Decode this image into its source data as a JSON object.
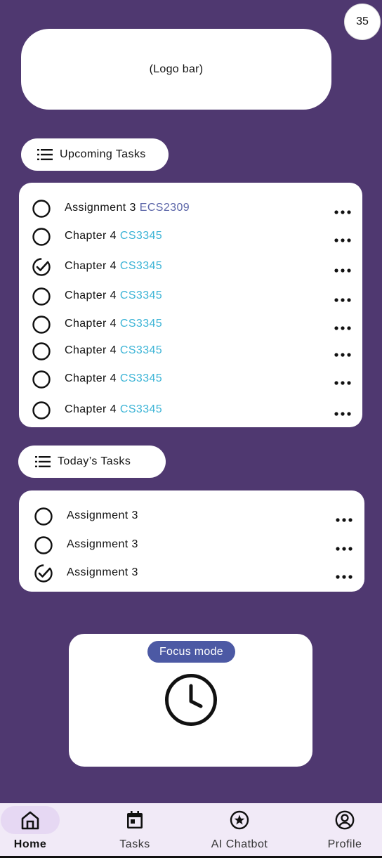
{
  "header": {
    "badge_count": "35",
    "logo_bar_text": "(Logo bar)"
  },
  "upcoming": {
    "title": "Upcoming Tasks",
    "tasks": [
      {
        "name": "Assignment 3",
        "course": "ECS2309",
        "done": false
      },
      {
        "name": "Chapter 4",
        "course": "CS3345",
        "done": false
      },
      {
        "name": "Chapter 4",
        "course": "CS3345",
        "done": true
      },
      {
        "name": "Chapter 4",
        "course": "CS3345",
        "done": false
      },
      {
        "name": "Chapter 4",
        "course": "CS3345",
        "done": false
      },
      {
        "name": "Chapter 4",
        "course": "CS3345",
        "done": false
      },
      {
        "name": "Chapter 4",
        "course": "CS3345",
        "done": false
      },
      {
        "name": "Chapter 4",
        "course": "CS3345",
        "done": false
      }
    ]
  },
  "today": {
    "title": "Today’s Tasks",
    "tasks": [
      {
        "name": "Assignment 3",
        "done": false
      },
      {
        "name": "Assignment 3",
        "done": false
      },
      {
        "name": "Assignment 3",
        "done": true
      }
    ]
  },
  "focus": {
    "button_label": "Focus mode",
    "icon": "clock-icon"
  },
  "nav": {
    "items": [
      {
        "label": "Home",
        "icon": "home-icon",
        "active": true
      },
      {
        "label": "Tasks",
        "icon": "calendar-icon",
        "active": false
      },
      {
        "label": "AI Chatbot",
        "icon": "star-icon",
        "active": false
      },
      {
        "label": "Profile",
        "icon": "account-icon",
        "active": false
      }
    ]
  },
  "colors": {
    "background": "#4f3870",
    "course_first": "#5b65a8",
    "course": "#3cb4d6",
    "focus_button": "#4c59a4",
    "nav_background": "#f1eaf7",
    "nav_active": "#e6d8f3"
  }
}
